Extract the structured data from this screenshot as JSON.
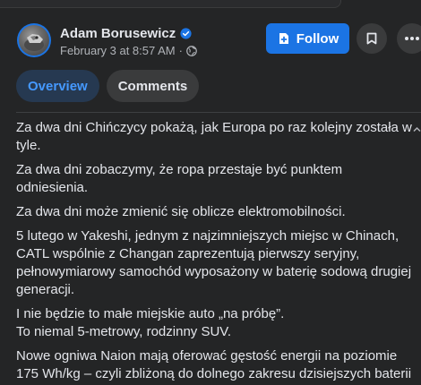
{
  "author": {
    "name": "Adam Borusewicz",
    "verified": true,
    "timestamp": "February 3 at 8:57 AM",
    "separator": "·",
    "audience_icon": "globe-icon"
  },
  "actions": {
    "follow_label": "Follow",
    "follow_icon": "add-page-icon",
    "save_icon": "bookmark-icon",
    "more_icon": "more-dots-icon"
  },
  "tabs": [
    {
      "label": "Overview",
      "active": true
    },
    {
      "label": "Comments",
      "active": false
    }
  ],
  "post": {
    "paragraphs": [
      "Za dwa dni Chińczycy pokażą, jak Europa po raz kolejny została w tyle.",
      "Za dwa dni zobaczymy, że ropa przestaje być punktem odniesienia.",
      "Za dwa dni może zmienić się oblicze elektromobilności.",
      "5 lutego w Yakeshi, jednym z najzimniejszych miejsc w Chinach, CATL wspólnie z Changan zaprezentują pierwszy seryjny, pełnowymiarowy samochód wyposażony w baterię sodową drugiej generacji.",
      "I nie będzie to małe miejskie auto „na próbę”.",
      "To niemal 5-metrowy, rodzinny SUV.",
      "Nowe ogniwa Naion mają oferować gęstość energii na poziomie 175 Wh/kg – czyli zbliżoną do dolnego zakresu dzisiejszych baterii"
    ]
  },
  "colors": {
    "background": "#242526",
    "accent": "#1b74e4",
    "active_tab_bg": "#263951",
    "active_tab_text": "#4599ff",
    "secondary_text": "#b0b3b8"
  }
}
